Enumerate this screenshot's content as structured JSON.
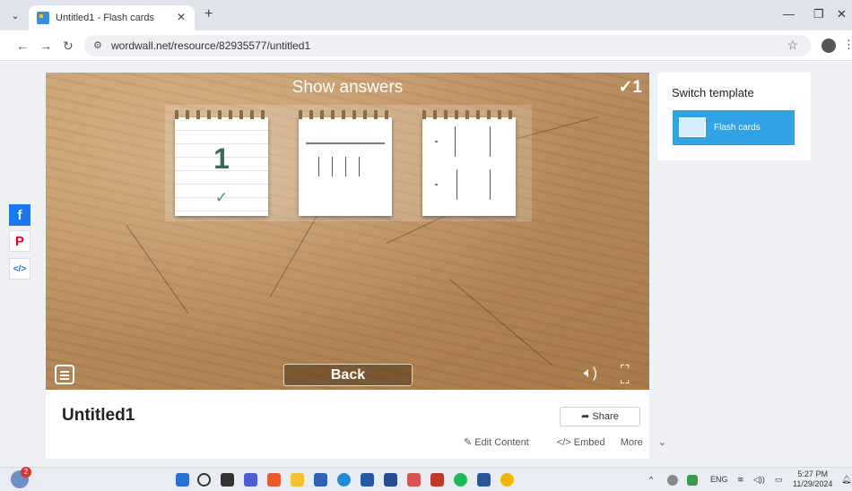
{
  "browser": {
    "tab_title": "Untitled1 - Flash cards",
    "url": "wordwall.net/resource/82935577/untitled1",
    "new_tab_icon": "plus-icon"
  },
  "game": {
    "title": "Show answers",
    "score": "✓1",
    "card1_number": "1",
    "back_label": "Back"
  },
  "activity": {
    "title": "Untitled1",
    "share_label": "Share",
    "edit_content_label": "Edit Content",
    "embed_label": "</> Embed",
    "more_label": "More"
  },
  "switch_template": {
    "title": "Switch template",
    "option_label": "Flash cards"
  },
  "social": [
    "facebook-icon",
    "pinterest-icon",
    "embed-icon"
  ],
  "taskbar": {
    "language": "ENG",
    "time": "5:27 PM",
    "date": "11/29/2024"
  },
  "colors": {
    "accent": "#2fa3e6",
    "facebook": "#1877f2",
    "pinterest": "#e60023",
    "correct": "#3aa54a"
  }
}
